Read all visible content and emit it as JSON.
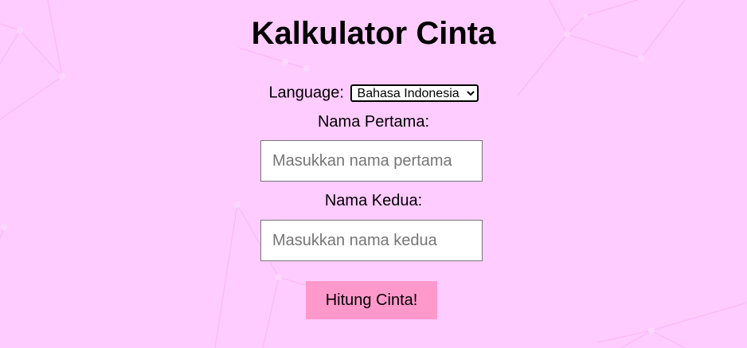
{
  "page": {
    "title": "Kalkulator Cinta",
    "background_color": "#ffccff"
  },
  "language": {
    "label": "Language:",
    "selected": "Bahasa Indonesia",
    "options": [
      "Bahasa Indonesia"
    ]
  },
  "form": {
    "first_name_label": "Nama Pertama:",
    "first_name_placeholder": "Masukkan nama pertama",
    "first_name_value": "",
    "second_name_label": "Nama Kedua:",
    "second_name_placeholder": "Masukkan nama kedua",
    "second_name_value": "",
    "submit_label": "Hitung Cinta!",
    "submit_color": "#ff99cc"
  }
}
